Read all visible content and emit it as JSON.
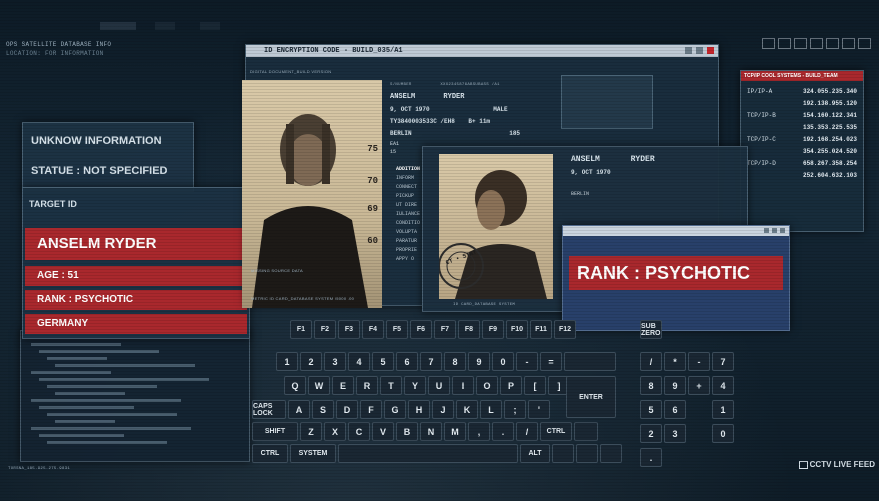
{
  "header": {
    "db_title": "OPS SATELLITE DATABASE INFO",
    "db_sub": "LOCATION: FOR INFORMATION"
  },
  "encryption_window": {
    "title": "ID ENCRYPTION CODE - BUILD_035/A1",
    "panel_label": "DIGITAL DOCUMENT_BUILD VERSION",
    "source_label": "MISSING SOURCE DATA",
    "biometric_label": "METRIC ID CARD_DATABASE SYSTEM /5000 .00",
    "scale_marks": [
      "75",
      "70",
      "69",
      "60"
    ],
    "card_header": "S/NUMBER",
    "card_code": "XXX2345876ABSUBASS /A1",
    "first_name": "ANSELM",
    "last_name": "RYDER",
    "dob": "9, OCT 1970",
    "sex": "MALE",
    "id_code": "TY3840003533C /EH8",
    "field2": "B+ 11m",
    "city": "BERLIN",
    "height": "185",
    "mini1": "EA1",
    "mini2": "15"
  },
  "addition_list": [
    "ADDITION",
    "INFORM",
    "CONNECT",
    "PICKUP",
    "UT DIRE",
    "IULIANCE",
    "CONDITIO",
    "VOLUPTA",
    "PARATUR",
    "PROPRIE",
    "APPY O"
  ],
  "second_card": {
    "first_name": "ANSELM",
    "last_name": "RYDER",
    "dob": "9, OCT 1970",
    "city": "BERLIN",
    "footer": "ID CARD_DATABASE SYSTEM",
    "stamp_text": "CT • STAT"
  },
  "left_info": {
    "line1": "UNKNOW INFORMATION",
    "line2": "STATUE : NOT SPECIFIED"
  },
  "target_panel": {
    "title": "TARGET ID",
    "name": "ANSELM RYDER",
    "age": "AGE : 51",
    "rank": "RANK : PSYCHOTIC",
    "country": "GERMANY"
  },
  "rank_popup": {
    "text": "RANK : PSYCHOTIC"
  },
  "right_panel": {
    "title": "TCP/IP COOL SYSTEMS - BUILD_TEAM",
    "rows": [
      {
        "label": "IP/IP-A",
        "value": "324.055.235.340"
      },
      {
        "label": "",
        "value": "192.138.955.120"
      },
      {
        "label": "TCP/IP-B",
        "value": "154.160.122.341"
      },
      {
        "label": "",
        "value": "135.353.225.535"
      },
      {
        "label": "TCP/IP-C",
        "value": "192.168.254.023"
      },
      {
        "label": "",
        "value": "354.255.024.520"
      },
      {
        "label": "TCP/IP-D",
        "value": "658.267.358.254"
      },
      {
        "label": "",
        "value": "252.604.632.103"
      }
    ]
  },
  "footer": {
    "cctv": "CCTV LIVE FEED",
    "coords": "TORSNA_185.925.275.9831"
  },
  "keyboard": {
    "fn_row": [
      "F1",
      "F2",
      "F3",
      "F4",
      "F5",
      "F6",
      "F7",
      "F8",
      "F9",
      "F10",
      "F11",
      "F12"
    ],
    "num_row": [
      "1",
      "2",
      "3",
      "4",
      "5",
      "6",
      "7",
      "8",
      "9",
      "0",
      "-",
      "="
    ],
    "q_row": [
      "Q",
      "W",
      "E",
      "R",
      "T",
      "Y",
      "U",
      "I",
      "O",
      "P",
      "[",
      "]"
    ],
    "a_row": [
      "A",
      "S",
      "D",
      "F",
      "G",
      "H",
      "J",
      "K",
      "L",
      ";",
      "'"
    ],
    "z_row": [
      "Z",
      "X",
      "C",
      "V",
      "B",
      "N",
      "M",
      ",",
      ".",
      "/"
    ],
    "caps": "CAPS LOCK",
    "shift": "SHIFT",
    "ctrl": "CTRL",
    "system": "SYSTEM",
    "alt": "ALT",
    "ctrl2": "CTRL",
    "enter": "ENTER",
    "numpad": [
      "/",
      "*",
      "-",
      "7",
      "8",
      "9",
      "+",
      "4",
      "5",
      "6",
      "",
      "1",
      "2",
      "3",
      "",
      "0",
      ".",
      ""
    ],
    "sub_label": "SUB ZERO"
  }
}
